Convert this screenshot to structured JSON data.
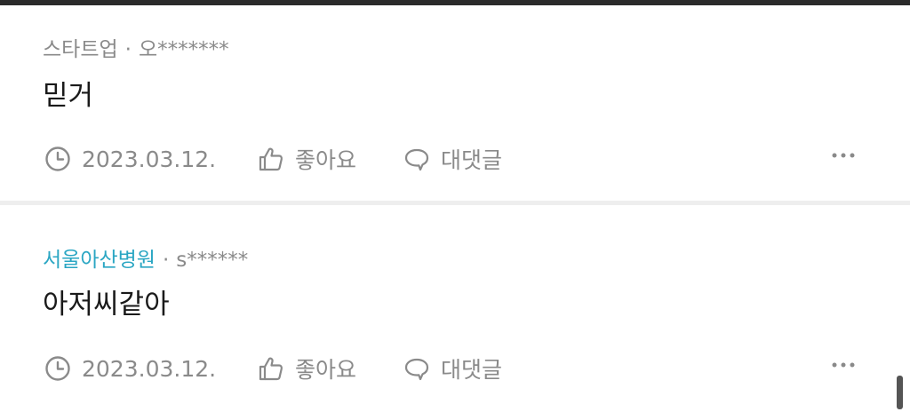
{
  "comments": [
    {
      "group": "스타트업",
      "group_accent": false,
      "separator": "·",
      "author": "오*******",
      "text": "믿거",
      "date": "2023.03.12.",
      "like_label": "좋아요",
      "reply_label": "대댓글",
      "more_label": "···"
    },
    {
      "group": "서울아산병원",
      "group_accent": true,
      "separator": "·",
      "author": "s******",
      "text": "아저씨같아",
      "date": "2023.03.12.",
      "like_label": "좋아요",
      "reply_label": "대댓글",
      "more_label": "···"
    }
  ],
  "colors": {
    "accent_group": "#2aa6c3",
    "meta_gray": "#8a8a8a",
    "text_dark": "#1a1a1a",
    "divider": "#eeeeee"
  },
  "icons": {
    "date": "clock-icon",
    "like": "thumbs-up-icon",
    "reply": "speech-bubble-icon",
    "more": "more-horizontal-icon"
  }
}
